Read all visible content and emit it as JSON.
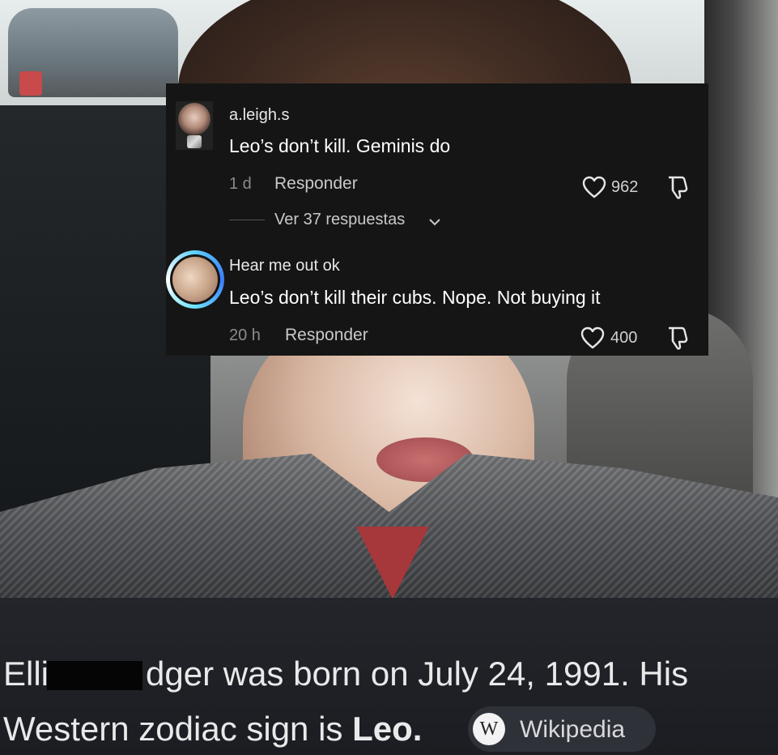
{
  "comments": [
    {
      "username": "a.leigh.s",
      "text": "Leo’s don’t kill. Geminis do",
      "time": "1 d",
      "reply_label": "Responder",
      "likes": "962",
      "view_replies": "Ver 37 respuestas"
    },
    {
      "username": "Hear me out ok",
      "text": "Leo’s don’t kill their cubs. Nope. Not buying it",
      "time": "20 h",
      "reply_label": "Responder",
      "likes": "400"
    }
  ],
  "caption": {
    "line1_prefix": "Elli",
    "line1_rest": "dger was born on July 24, 1991. His",
    "line2_prefix": "Western zodiac sign is ",
    "line2_bold": "Leo.",
    "source_label": "Wikipedia",
    "source_logo": "W"
  },
  "icons": {
    "heart": "heart-outline",
    "dislike": "thumbs-down-outline",
    "chevron": "chevron-down"
  },
  "colors": {
    "overlay_bg": "#151515",
    "caption_bg": "#1f2126",
    "story_ring": "#5ed0ff"
  }
}
